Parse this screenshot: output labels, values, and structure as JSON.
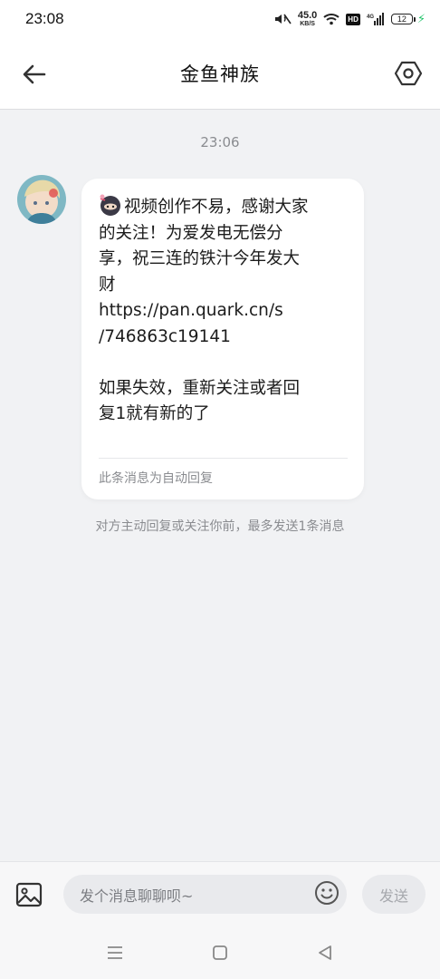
{
  "status_bar": {
    "time": "23:08",
    "net_speed_value": "45.0",
    "net_speed_unit": "KB/S",
    "hd_label": "HD",
    "network_type": "4G",
    "battery_level": "12"
  },
  "header": {
    "title": "金鱼神族"
  },
  "chat": {
    "timestamp": "23:06",
    "message": {
      "lines": [
        "视频创作不易，感谢大家",
        "的关注！为爱发电无偿分",
        "享，祝三连的铁汁今年发大",
        "财",
        "https://pan.quark.cn/s",
        "/746863c19141",
        "",
        "如果失效，重新关注或者回",
        "复1就有新的了"
      ],
      "auto_reply_label": "此条消息为自动回复"
    },
    "notice": "对方主动回复或关注你前，最多发送1条消息"
  },
  "input": {
    "placeholder": "发个消息聊聊呗~",
    "send_label": "发送"
  },
  "icons": {
    "back": "arrow-left-icon",
    "settings": "hexagon-gear-icon",
    "image": "image-icon",
    "emoji": "smiley-icon"
  }
}
